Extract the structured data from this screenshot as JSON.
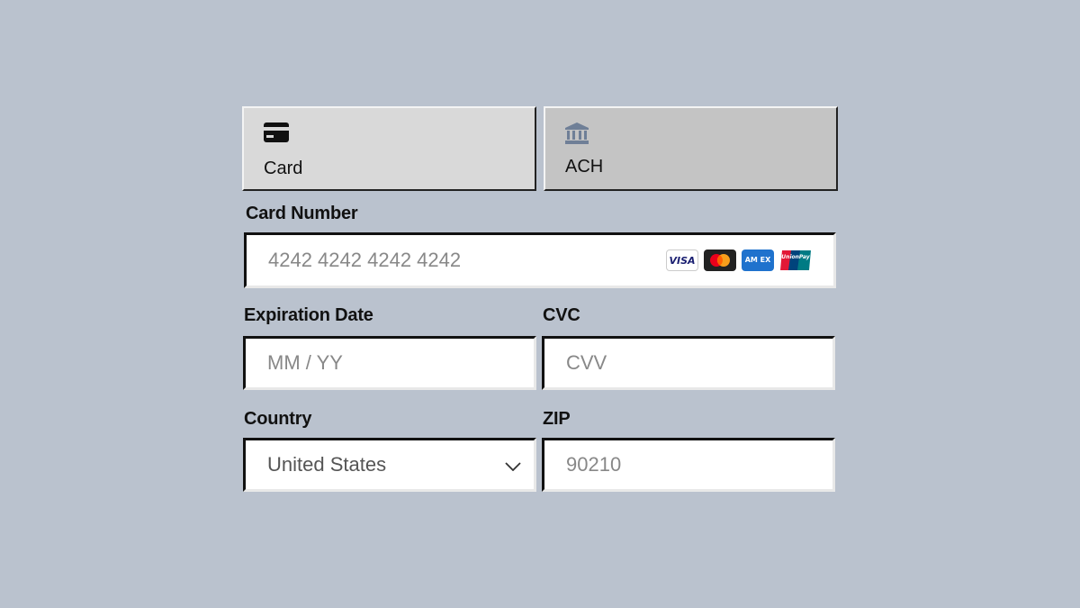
{
  "tabs": [
    {
      "label": "Card",
      "icon": "credit-card-icon",
      "selected": true
    },
    {
      "label": "ACH",
      "icon": "bank-icon",
      "selected": false
    }
  ],
  "card_number": {
    "label": "Card Number",
    "placeholder": "4242 4242 4242 4242",
    "brands": [
      "visa-icon",
      "mastercard-icon",
      "amex-icon",
      "unionpay-icon"
    ],
    "brand_text": {
      "visa": "VISA",
      "amex": "AM EX",
      "unionpay": "UnionPay"
    }
  },
  "expiration": {
    "label": "Expiration Date",
    "placeholder": "MM / YY"
  },
  "cvc": {
    "label": "CVC",
    "placeholder": "CVV"
  },
  "country": {
    "label": "Country",
    "value": "United States"
  },
  "zip": {
    "label": "ZIP",
    "placeholder": "90210"
  },
  "colors": {
    "background": "#bac2ce",
    "tab_selected": "#d9d9d9",
    "tab_unselected": "#c4c4c4",
    "bank_icon": "#6f7f97"
  }
}
